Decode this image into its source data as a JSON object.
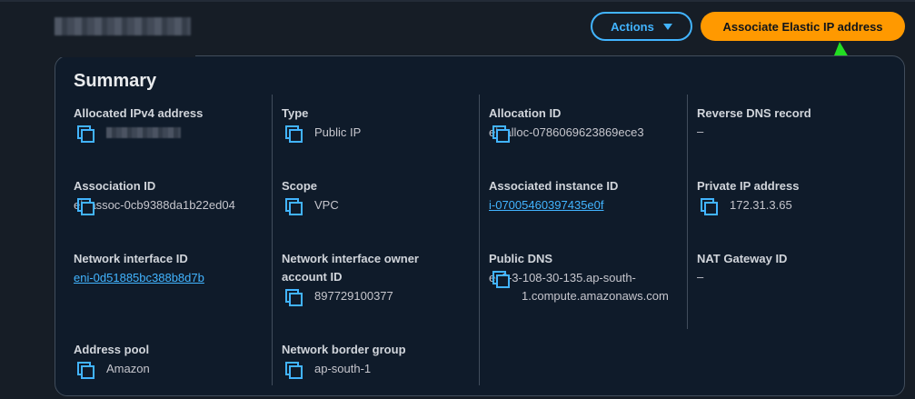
{
  "header": {
    "actions_label": "Actions",
    "primary_label": "Associate Elastic IP address"
  },
  "summary": {
    "title": "Summary",
    "allocated_ipv4": {
      "label": "Allocated IPv4 address"
    },
    "type": {
      "label": "Type",
      "value": "Public IP"
    },
    "allocation_id": {
      "label": "Allocation ID",
      "value": "eipalloc-0786069623869ece3"
    },
    "reverse_dns": {
      "label": "Reverse DNS record",
      "value": "–"
    },
    "association_id": {
      "label": "Association ID",
      "value": "eipassoc-0cb9388da1b22ed04"
    },
    "scope": {
      "label": "Scope",
      "value": "VPC"
    },
    "associated_instance_id": {
      "label": "Associated instance ID",
      "value": "i-07005460397435e0f"
    },
    "private_ip": {
      "label": "Private IP address",
      "value": "172.31.3.65"
    },
    "network_interface_id": {
      "label": "Network interface ID",
      "value": "eni-0d51885bc388b8d7b"
    },
    "network_interface_owner": {
      "label": "Network interface owner account ID",
      "value": "897729100377"
    },
    "public_dns": {
      "label": "Public DNS",
      "value": "ec2-3-108-30-135.ap-south-1.compute.amazonaws.com"
    },
    "nat_gateway_id": {
      "label": "NAT Gateway ID",
      "value": "–"
    },
    "address_pool": {
      "label": "Address pool",
      "value": "Amazon"
    },
    "network_border_group": {
      "label": "Network border group",
      "value": "ap-south-1"
    }
  },
  "colors": {
    "accent": "#42b4ff",
    "primary": "#ff9900",
    "annotation_arrow": "#22dd22"
  }
}
